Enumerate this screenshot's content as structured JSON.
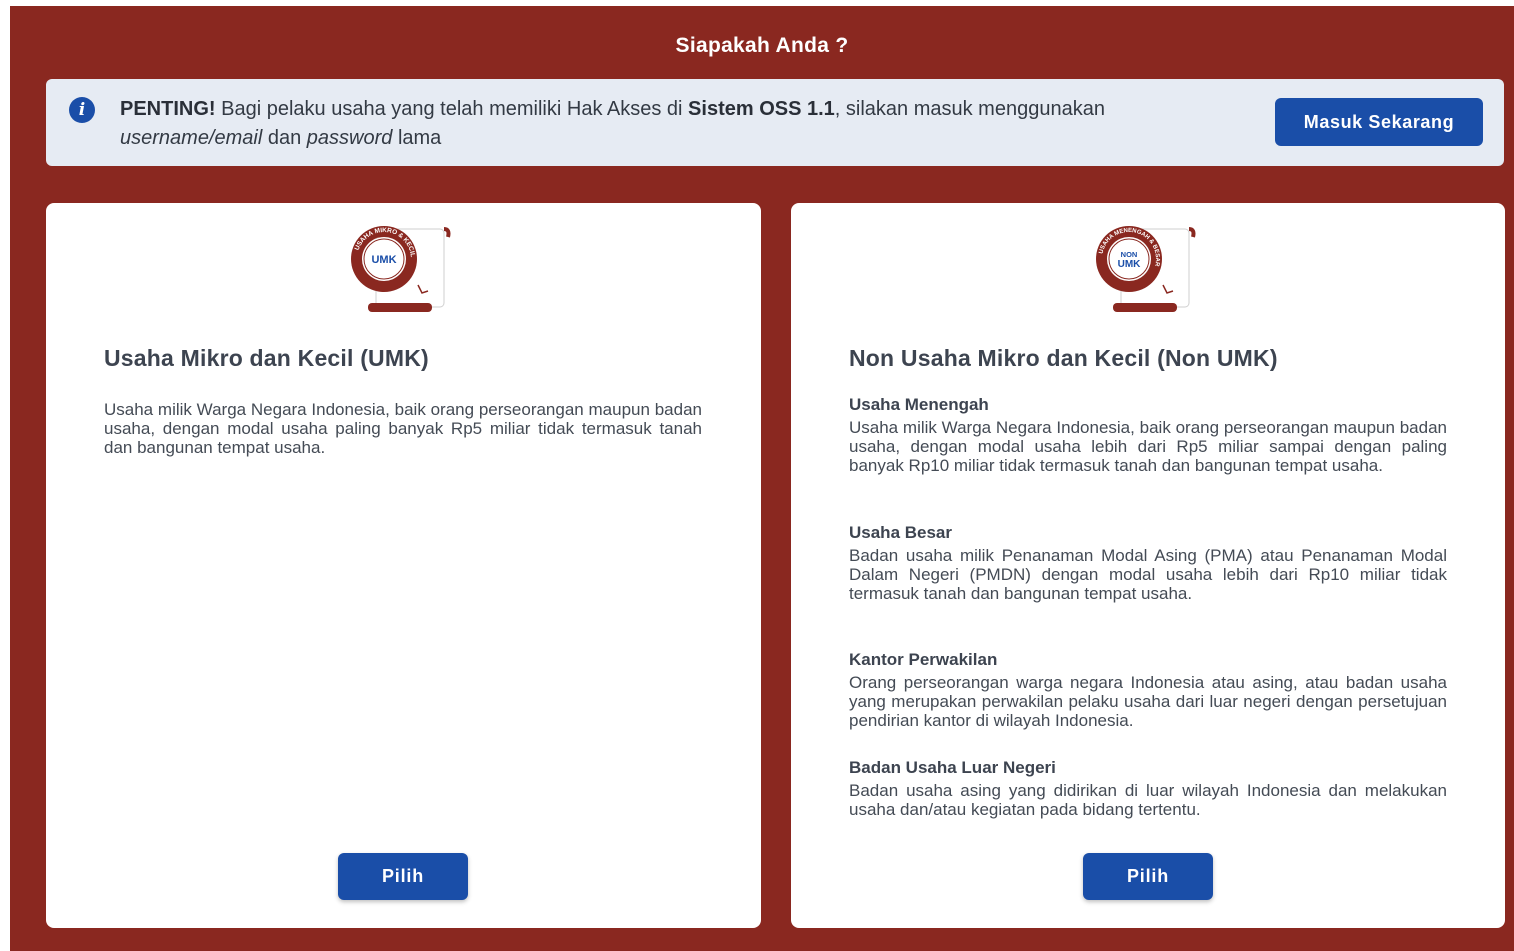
{
  "page": {
    "title": "Siapakah Anda ?"
  },
  "notice": {
    "bold_label": "PENTING!",
    "text_1": " Bagi pelaku usaha yang telah memiliki Hak Akses di ",
    "system_name": "Sistem OSS 1.1",
    "text_2": ", silakan masuk menggunakan ",
    "username_text": "username/email",
    "text_3": " dan ",
    "password_text": "password",
    "text_4": " lama",
    "button_label": "Masuk Sekarang",
    "icon": "info-icon"
  },
  "umk_card": {
    "logo_text": "UMK",
    "logo_ring_text": "USAHA MIKRO & KECIL",
    "title": "Usaha Mikro dan Kecil (UMK)",
    "description": "Usaha milik Warga Negara Indonesia, baik orang perseorangan maupun badan usaha, dengan modal usaha paling banyak Rp5 miliar tidak termasuk tanah dan bangunan tempat usaha.",
    "button_label": "Pilih"
  },
  "non_umk_card": {
    "logo_text_1": "NON",
    "logo_text_2": "UMK",
    "logo_ring_text": "USAHA MENENGAH & BESAR",
    "title": "Non Usaha Mikro dan Kecil (Non UMK)",
    "sections": [
      {
        "title": "Usaha Menengah",
        "description": "Usaha milik Warga Negara Indonesia, baik orang perseorangan maupun badan usaha, dengan modal usaha lebih dari Rp5 miliar sampai dengan paling banyak Rp10 miliar tidak termasuk tanah dan bangunan tempat usaha."
      },
      {
        "title": "Usaha Besar",
        "description": "Badan usaha milik Penanaman Modal Asing (PMA) atau Penanaman Modal Dalam Negeri (PMDN) dengan modal usaha lebih dari Rp10 miliar tidak termasuk tanah dan bangunan tempat usaha."
      },
      {
        "title": "Kantor Perwakilan",
        "description": "Orang perseorangan warga negara Indonesia atau asing, atau badan usaha yang merupakan perwakilan pelaku usaha dari luar negeri dengan persetujuan pendirian kantor di wilayah Indonesia."
      },
      {
        "title": "Badan Usaha Luar Negeri",
        "description": "Badan usaha asing yang didirikan di luar wilayah Indonesia dan melakukan usaha dan/atau kegiatan pada bidang tertentu."
      }
    ],
    "button_label": "Pilih"
  },
  "colors": {
    "background": "#8a2820",
    "primary_button": "#1a4ea8",
    "notice_bg": "#e6ebf3"
  }
}
